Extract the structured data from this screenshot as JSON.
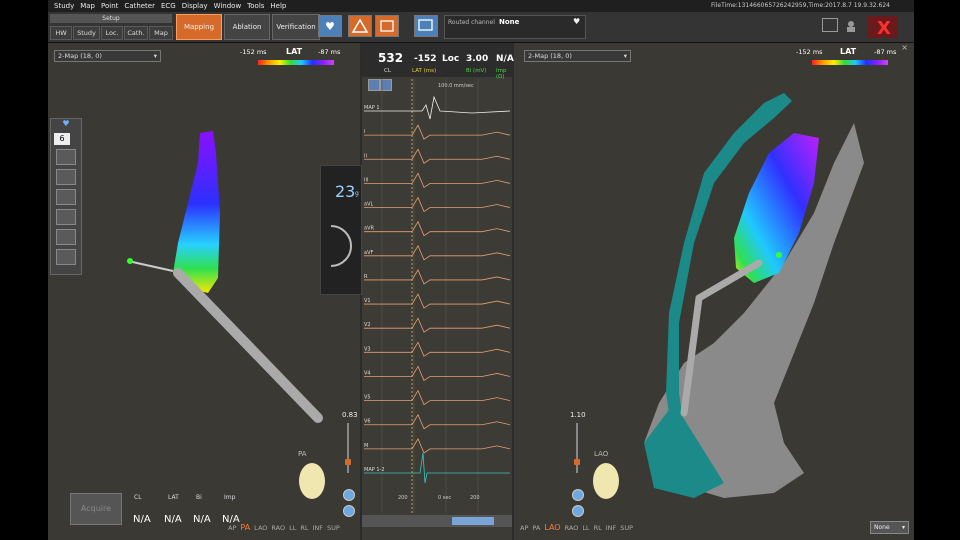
{
  "menu": [
    "Study",
    "Map",
    "Point",
    "Catheter",
    "ECG",
    "Display",
    "Window",
    "Tools",
    "Help"
  ],
  "file_time": "FileTime:131466065726242959,Time:2017.8.7 19.9.32.624",
  "toolbar": {
    "setup": "Setup",
    "subtabs": [
      "HW",
      "Study",
      "Loc.",
      "Cath.",
      "Map"
    ],
    "mapping": "Mapping",
    "ablation": "Ablation",
    "verification": "Verification",
    "routed_label": "Routed channel",
    "routed_value": "None"
  },
  "left_panel": {
    "map_selector": "2-Map (18, 0)",
    "lat_min": "-152 ms",
    "lat_label": "LAT",
    "lat_max": "-87 ms",
    "tool_number": "6",
    "counter": "23",
    "counter_sub": "g",
    "zoom": "0.83",
    "view_label": "PA",
    "views": [
      "AP",
      "PA",
      "LAO",
      "RAO",
      "LL",
      "RL",
      "INF",
      "SUP"
    ],
    "active_view": "PA"
  },
  "right_panel": {
    "map_selector": "2-Map (18, 0)",
    "lat_min": "-152 ms",
    "lat_label": "LAT",
    "lat_max": "-87 ms",
    "zoom": "1.10",
    "view_label": "LAO",
    "views": [
      "AP",
      "PA",
      "LAO",
      "RAO",
      "LL",
      "RL",
      "INF",
      "SUP"
    ],
    "active_view": "LAO",
    "dropdown": "None"
  },
  "ecg": {
    "cl_value": "532",
    "cl_label": "CL",
    "lat_value": "-152",
    "lat_label": "LAT (ms)",
    "loc": "Loc",
    "bi_value": "3.00",
    "bi_label": "Bi (mV)",
    "imp_value": "N/A",
    "imp_label": "Imp (Ω)",
    "speed": "100.0 mm/sec",
    "leads": [
      "MAP 1",
      "I",
      "II",
      "III",
      "aVL",
      "aVR",
      "aVF",
      "R",
      "V1",
      "V2",
      "V3",
      "V4",
      "V5",
      "V6",
      "M",
      "MAP 1-2"
    ],
    "x_ticks": [
      "200",
      "0 sec",
      "200"
    ]
  },
  "acquire": {
    "button": "Acquire",
    "headers": [
      "CL",
      "LAT",
      "Bi",
      "Imp"
    ],
    "values": [
      "N/A",
      "N/A",
      "N/A",
      "N/A"
    ]
  }
}
